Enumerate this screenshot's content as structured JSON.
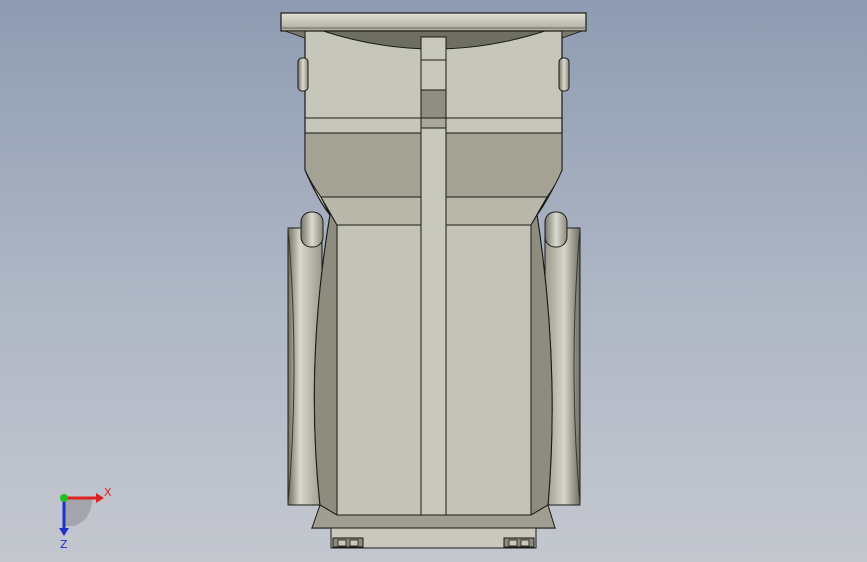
{
  "viewport": {
    "background_top": "#8e9bb1",
    "background_bottom": "#c4c7ce"
  },
  "model": {
    "face_color": "#c6c6ba",
    "shadow_color": "#898879",
    "edge_color": "#1a1a16"
  },
  "triad": {
    "x_label": "X",
    "z_label": "Z",
    "x_color": "#e02020",
    "y_color": "#20c020",
    "z_color": "#2030d0"
  }
}
